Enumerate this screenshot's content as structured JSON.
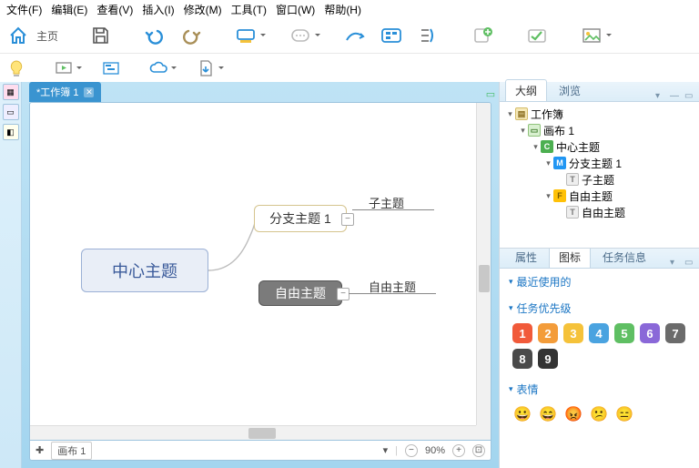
{
  "menu": {
    "items": [
      "文件(F)",
      "编辑(E)",
      "查看(V)",
      "插入(I)",
      "修改(M)",
      "工具(T)",
      "窗口(W)",
      "帮助(H)"
    ]
  },
  "tabs": {
    "workbook": "*工作簿 1"
  },
  "canvas": {
    "center": "中心主题",
    "branch": "分支主题 1",
    "free": "自由主题",
    "sub": "子主题",
    "free_sub": "自由主题"
  },
  "statusbar": {
    "sheet": "画布 1",
    "zoom": "90%"
  },
  "right_tabs": {
    "outline": "大纲",
    "browse": "浏览",
    "props": "属性",
    "markers": "图标",
    "taskinfo": "任务信息"
  },
  "outline": {
    "workbook": "工作簿",
    "canvas": "画布 1",
    "center": "中心主题",
    "branch": "分支主题 1",
    "sub": "子主题",
    "free_topic": "自由主题",
    "free_child": "自由主题"
  },
  "sections": {
    "recent": "最近使用的",
    "priority": "任务优先级",
    "emotion": "表情"
  },
  "priorities": [
    {
      "n": "1",
      "c": "#f15a3a"
    },
    {
      "n": "2",
      "c": "#f39c3a"
    },
    {
      "n": "3",
      "c": "#f5c23a"
    },
    {
      "n": "4",
      "c": "#4aa3e0"
    },
    {
      "n": "5",
      "c": "#5fbf63"
    },
    {
      "n": "6",
      "c": "#8a68d8"
    },
    {
      "n": "7",
      "c": "#6b6b6b"
    },
    {
      "n": "8",
      "c": "#4a4a4a"
    },
    {
      "n": "9",
      "c": "#333333"
    }
  ],
  "emojis": [
    "😀",
    "😄",
    "😡",
    "😕",
    "😑"
  ]
}
